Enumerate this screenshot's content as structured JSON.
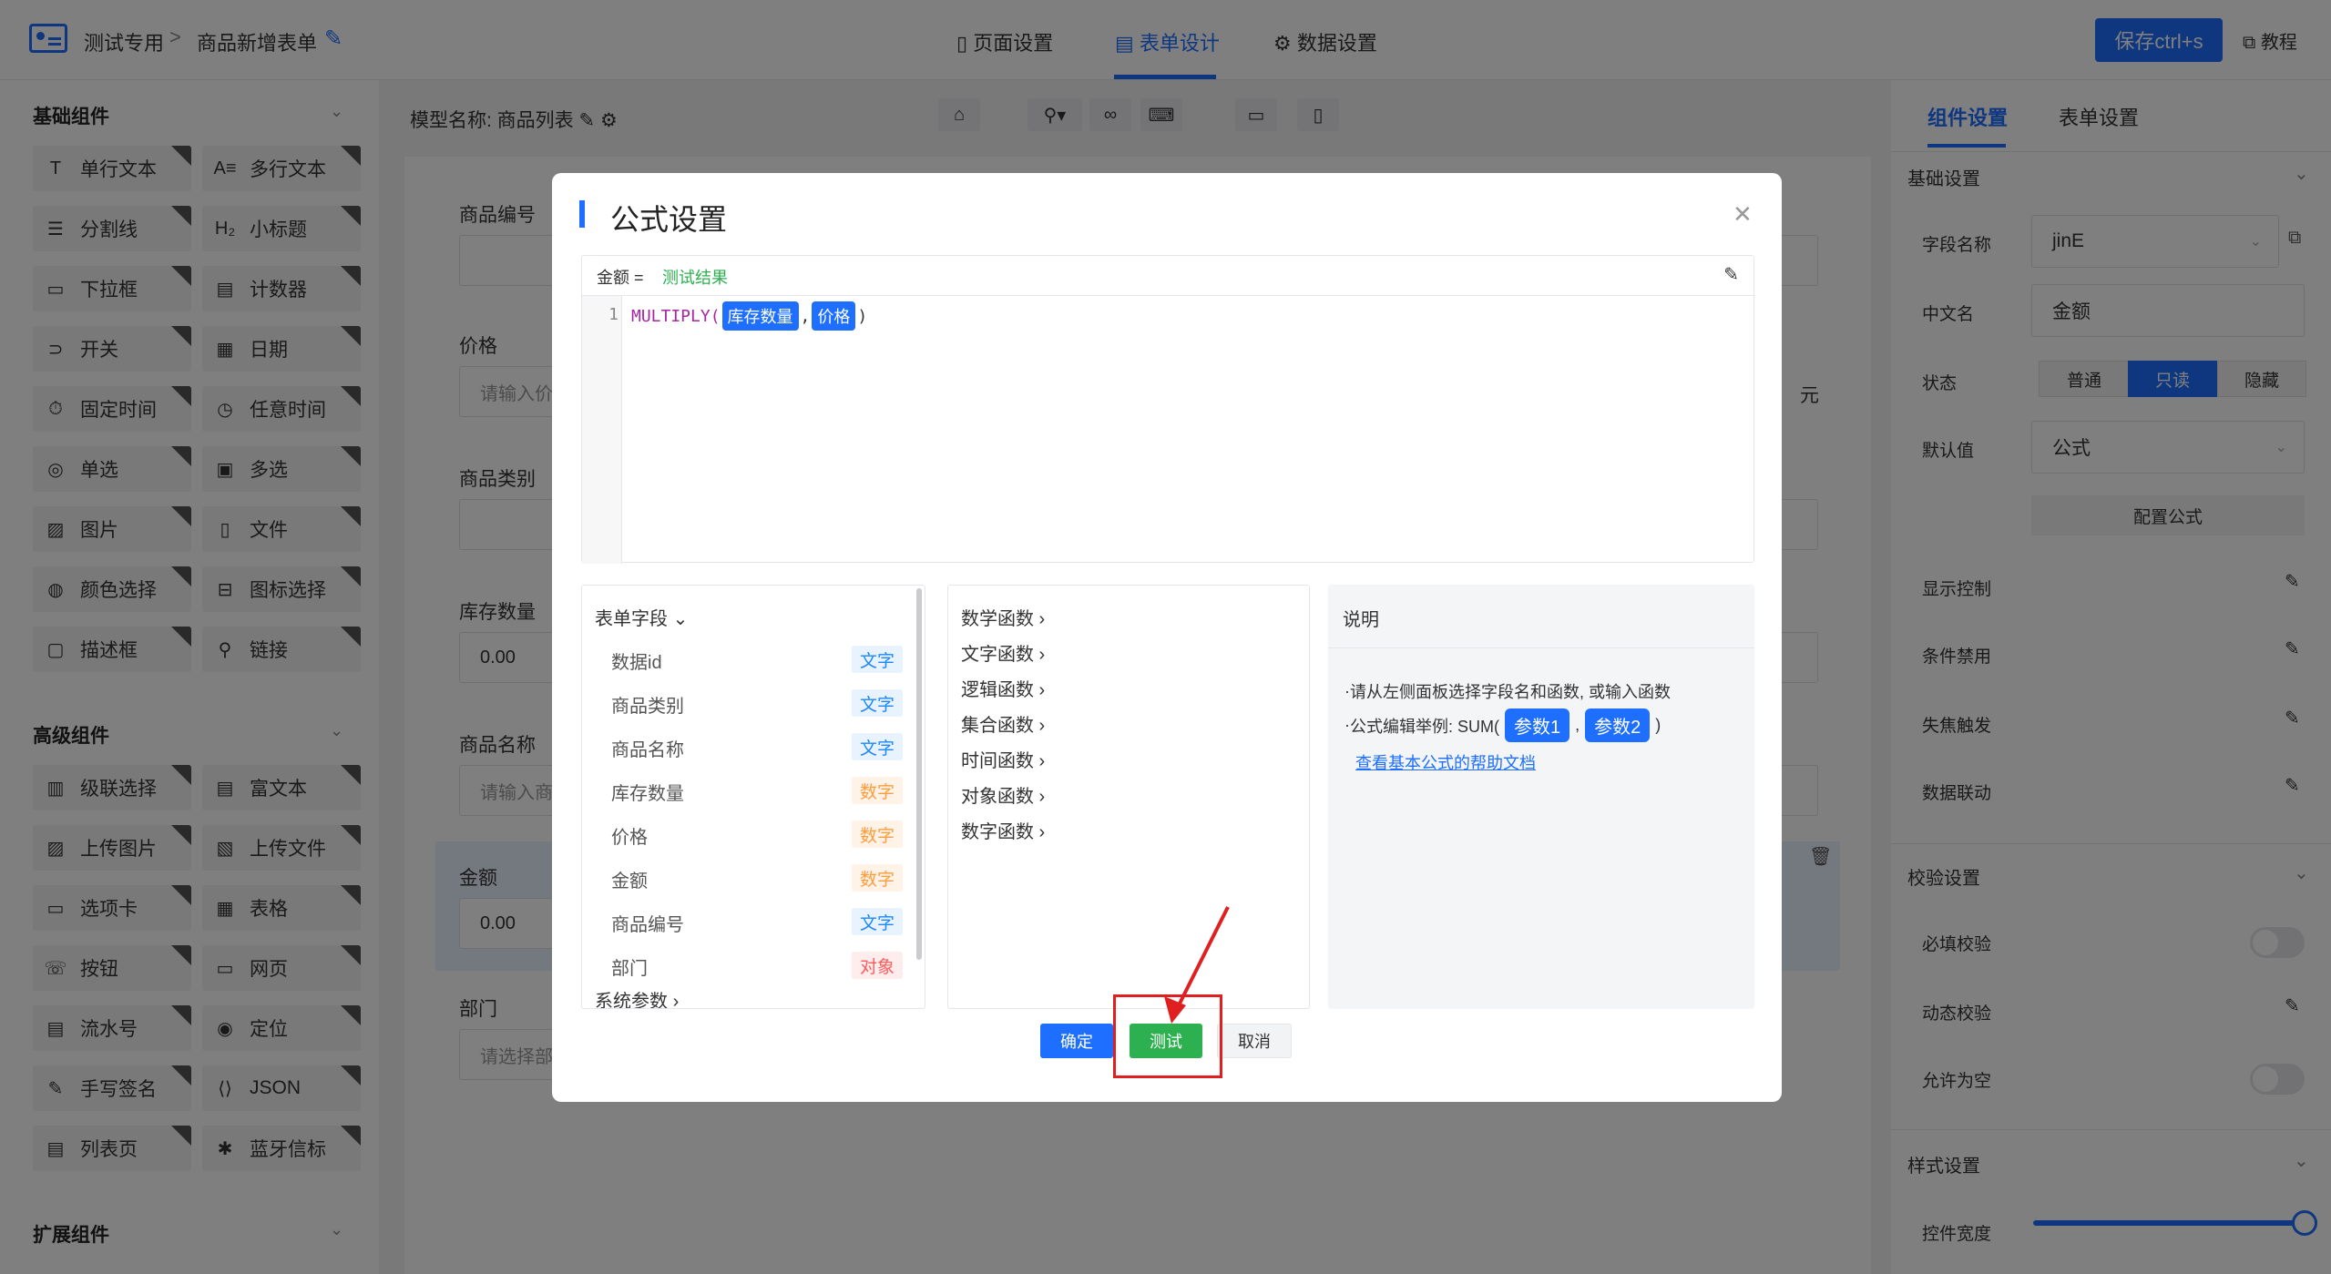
{
  "header": {
    "breadcrumb1": "测试专用",
    "breadcrumb_sep": ">",
    "breadcrumb2": "商品新增表单",
    "tabs": [
      {
        "label": "页面设置",
        "icon": "bookmark-icon"
      },
      {
        "label": "表单设计",
        "icon": "doc-icon"
      },
      {
        "label": "数据设置",
        "icon": "gear-icon"
      }
    ],
    "save_label": "保存ctrl+s",
    "tutorial_label": "教程"
  },
  "left": {
    "basic_title": "基础组件",
    "basic": [
      [
        "T",
        "单行文本"
      ],
      [
        "A≡",
        "多行文本"
      ],
      [
        "☰",
        "分割线"
      ],
      [
        "H₂",
        "小标题"
      ],
      [
        "▭",
        "下拉框"
      ],
      [
        "▤",
        "计数器"
      ],
      [
        "⊃",
        "开关"
      ],
      [
        "▦",
        "日期"
      ],
      [
        "⏱",
        "固定时间"
      ],
      [
        "◷",
        "任意时间"
      ],
      [
        "◎",
        "单选"
      ],
      [
        "▣",
        "多选"
      ],
      [
        "▨",
        "图片"
      ],
      [
        "▯",
        "文件"
      ],
      [
        "◍",
        "颜色选择"
      ],
      [
        "⊟",
        "图标选择"
      ],
      [
        "▢",
        "描述框"
      ],
      [
        "⚲",
        "链接"
      ]
    ],
    "advanced_title": "高级组件",
    "advanced": [
      [
        "▥",
        "级联选择"
      ],
      [
        "▤",
        "富文本"
      ],
      [
        "▨",
        "上传图片"
      ],
      [
        "▧",
        "上传文件"
      ],
      [
        "▭",
        "选项卡"
      ],
      [
        "▦",
        "表格"
      ],
      [
        "☏",
        "按钮"
      ],
      [
        "▭",
        "网页"
      ],
      [
        "▤",
        "流水号"
      ],
      [
        "◉",
        "定位"
      ],
      [
        "✎",
        "手写签名"
      ],
      [
        "⟨⟩",
        "JSON"
      ],
      [
        "▤",
        "列表页"
      ],
      [
        "✱",
        "蓝牙信标"
      ]
    ],
    "ext_title": "扩展组件"
  },
  "canvas": {
    "model_name": "模型名称: 商品列表",
    "labels": [
      "商品编号",
      "价格",
      "商品类别",
      "库存数量",
      "商品名称",
      "金额",
      "部门"
    ],
    "price_placeholder": "请输入价",
    "stock_value": "0.00",
    "name_placeholder": "请输入商",
    "amount_value": "0.00",
    "dept_placeholder": "请选择部",
    "unit": "元"
  },
  "right": {
    "tabs": [
      "组件设置",
      "表单设置"
    ],
    "basic_settings": "基础设置",
    "field_name_label": "字段名称",
    "field_name_value": "jinE",
    "cn_name_label": "中文名",
    "cn_name_value": "金额",
    "state_label": "状态",
    "state_options": [
      "普通",
      "只读",
      "隐藏"
    ],
    "default_label": "默认值",
    "default_value": "公式",
    "config_formula": "配置公式",
    "display_control": "显示控制",
    "condition_disable": "条件禁用",
    "blur_trigger": "失焦触发",
    "data_link": "数据联动",
    "validate_settings": "校验设置",
    "required_check": "必填校验",
    "dynamic_check": "动态校验",
    "allow_empty": "允许为空",
    "style_settings": "样式设置",
    "control_width": "控件宽度"
  },
  "modal": {
    "title": "公式设置",
    "lhs": "金额 =",
    "result": "测试结果",
    "line_no": "1",
    "func": "MULTIPLY(",
    "arg1": "库存数量",
    "comma": ",",
    "arg2": "价格",
    "close_paren": ")",
    "form_fields_title": "表单字段",
    "fields": [
      {
        "name": "数据id",
        "type": "文字",
        "kind": "text"
      },
      {
        "name": "商品类别",
        "type": "文字",
        "kind": "text"
      },
      {
        "name": "商品名称",
        "type": "文字",
        "kind": "text"
      },
      {
        "name": "库存数量",
        "type": "数字",
        "kind": "num"
      },
      {
        "name": "价格",
        "type": "数字",
        "kind": "num"
      },
      {
        "name": "金额",
        "type": "数字",
        "kind": "num"
      },
      {
        "name": "商品编号",
        "type": "文字",
        "kind": "text"
      },
      {
        "name": "部门",
        "type": "对象",
        "kind": "obj"
      }
    ],
    "system_params": "系统参数",
    "functions": [
      "数学函数",
      "文字函数",
      "逻辑函数",
      "集合函数",
      "时间函数",
      "对象函数",
      "数字函数"
    ],
    "desc_title": "说明",
    "desc_line1": "请从左侧面板选择字段名和函数, 或输入函数",
    "desc_line2_prefix": "公式编辑举例: SUM(",
    "desc_param1": "参数1",
    "desc_comma": ",",
    "desc_param2": "参数2",
    "desc_close": ")",
    "desc_link": "查看基本公式的帮助文档",
    "ok": "确定",
    "test": "测试",
    "cancel": "取消"
  },
  "colors": {
    "accent": "#1e6fff",
    "test_green": "#2db050",
    "annotation_red": "#e02020"
  }
}
